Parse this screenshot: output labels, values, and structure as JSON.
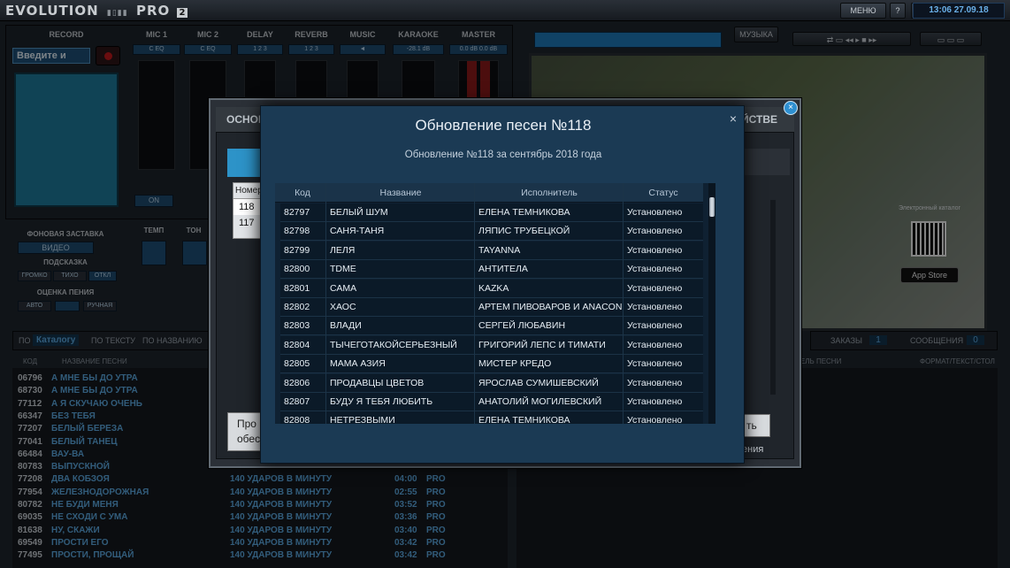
{
  "app": {
    "logo": "EVOLUTION",
    "logo_suffix": "PRO",
    "menu_label": "МЕНЮ",
    "help_label": "?",
    "clock": "13:06 27.09.18",
    "music_button": "МУЗЫКА"
  },
  "mixer": {
    "record_label": "RECORD",
    "record_input": "Введите и",
    "channels": [
      {
        "label": "MIC 1",
        "value": "C  EQ"
      },
      {
        "label": "MIC 2",
        "value": "C  EQ"
      },
      {
        "label": "DELAY",
        "value": "1  2  3"
      },
      {
        "label": "REVERB",
        "value": "1  2  3"
      },
      {
        "label": "MUSIC",
        "value": "◄"
      },
      {
        "label": "KARAOKE",
        "value": "-28.1 dB"
      },
      {
        "label": "MASTER",
        "value": "0.0 dB  0.0 dB"
      }
    ],
    "on_label": "ON",
    "background_label": "ФОНОВАЯ ЗАСТАВКА",
    "video_button": "ВИДЕО",
    "hint_label": "ПОДСКАЗКА",
    "hint_options": [
      "ГРОМКО",
      "ТИХО",
      "ОТКЛ"
    ],
    "rating_label": "ОЦЕНКА ПЕНИЯ",
    "rating_options": [
      "АВТО",
      "",
      "РУЧНАЯ"
    ],
    "tempo_label": "ТЕМП",
    "tone_label": "ТОН"
  },
  "video": {
    "catalog_text": "Электронный каталог",
    "appstore_text": "App Store"
  },
  "search": {
    "prefix": "ПО",
    "tabs": [
      "Каталогу",
      "ПО ТЕКСТУ",
      "ПО НАЗВАНИЮ"
    ],
    "col_code": "КОД",
    "col_title": "НАЗВАНИЕ ПЕСНИ",
    "col_artist_right": "ТЕЛЬ ПЕСНИ",
    "col_format": "ФОРМАТ/ТЕКСТ/СТОЛ"
  },
  "queue": {
    "orders_label": "ЗАКАЗЫ",
    "orders_count": "1",
    "messages_label": "СООБЩЕНИЯ",
    "messages_count": "0"
  },
  "bg_songs": [
    {
      "code": "06796",
      "title": "А МНЕ БЫ ДО УТРА",
      "artist": "",
      "time": "",
      "fmt": ""
    },
    {
      "code": "68730",
      "title": "А МНЕ БЫ ДО УТРА",
      "artist": "",
      "time": "",
      "fmt": ""
    },
    {
      "code": "77112",
      "title": "А Я СКУЧАЮ ОЧЕНЬ",
      "artist": "",
      "time": "",
      "fmt": ""
    },
    {
      "code": "66347",
      "title": "БЕЗ ТЕБЯ",
      "artist": "",
      "time": "",
      "fmt": ""
    },
    {
      "code": "77207",
      "title": "БЕЛЫЙ БЕРЕЗА",
      "artist": "",
      "time": "",
      "fmt": ""
    },
    {
      "code": "77041",
      "title": "БЕЛЫЙ ТАНЕЦ",
      "artist": "",
      "time": "",
      "fmt": ""
    },
    {
      "code": "66484",
      "title": "ВАУ-ВА",
      "artist": "",
      "time": "",
      "fmt": ""
    },
    {
      "code": "80783",
      "title": "ВЫПУСКНОЙ",
      "artist": "",
      "time": "",
      "fmt": ""
    },
    {
      "code": "77208",
      "title": "ДВА КОБЗОЯ",
      "artist": "140 УДАРОВ В МИНУТУ",
      "time": "04:00",
      "fmt": "PRO"
    },
    {
      "code": "77954",
      "title": "ЖЕЛЕЗНОДОРОЖНАЯ",
      "artist": "140 УДАРОВ В МИНУТУ",
      "time": "02:55",
      "fmt": "PRO"
    },
    {
      "code": "80782",
      "title": "НЕ БУДИ МЕНЯ",
      "artist": "140 УДАРОВ В МИНУТУ",
      "time": "03:52",
      "fmt": "PRO"
    },
    {
      "code": "69035",
      "title": "НЕ СХОДИ С УМА",
      "artist": "140 УДАРОВ В МИНУТУ",
      "time": "03:36",
      "fmt": "PRO"
    },
    {
      "code": "81638",
      "title": "НУ, СКАЖИ",
      "artist": "140 УДАРОВ В МИНУТУ",
      "time": "03:40",
      "fmt": "PRO"
    },
    {
      "code": "69549",
      "title": "ПРОСТИ ЕГО",
      "artist": "140 УДАРОВ В МИНУТУ",
      "time": "03:42",
      "fmt": "PRO"
    },
    {
      "code": "77495",
      "title": "ПРОСТИ, ПРОЩАЙ",
      "artist": "140 УДАРОВ В МИНУТУ",
      "time": "03:42",
      "fmt": "PRO"
    }
  ],
  "settings_dialog": {
    "tab_left": "ОСНОВЕ",
    "tab_right": "ЙСТВЕ",
    "col_number": "Номер",
    "numbers": [
      "118",
      "117"
    ],
    "bottom_left_1": "Про",
    "bottom_left_2": "обес",
    "bottom_right_1": "ть",
    "bottom_right_2": "ения"
  },
  "update_dialog": {
    "title": "Обновление песен №118",
    "subtitle": "Обновление №118 за сентябрь 2018 года",
    "close_icon": "×",
    "columns": {
      "code": "Код",
      "title": "Название",
      "artist": "Исполнитель",
      "status": "Статус"
    },
    "rows": [
      {
        "code": "82797",
        "title": "БЕЛЫЙ ШУМ",
        "artist": "ЕЛЕНА ТЕМНИКОВА",
        "status": "Установлено"
      },
      {
        "code": "82798",
        "title": "САНЯ-ТАНЯ",
        "artist": "ЛЯПИС ТРУБЕЦКОЙ",
        "status": "Установлено"
      },
      {
        "code": "82799",
        "title": "ЛЕЛЯ",
        "artist": "TAYANNA",
        "status": "Установлено"
      },
      {
        "code": "82800",
        "title": "TDME",
        "artist": "АНТИТЕЛА",
        "status": "Установлено"
      },
      {
        "code": "82801",
        "title": "САМА",
        "artist": "KAZKA",
        "status": "Установлено"
      },
      {
        "code": "82802",
        "title": "ХАОС",
        "artist": "АРТЕМ ПИВОВАРОВ И ANACONDAZ",
        "status": "Установлено"
      },
      {
        "code": "82803",
        "title": "ВЛАДИ",
        "artist": "СЕРГЕЙ ЛЮБАВИН",
        "status": "Установлено"
      },
      {
        "code": "82804",
        "title": "ТЫЧЕГОТАКОЙСЕРЬЕЗНЫЙ",
        "artist": "ГРИГОРИЙ ЛЕПС И ТИМАТИ",
        "status": "Установлено"
      },
      {
        "code": "82805",
        "title": "МАМА АЗИЯ",
        "artist": "МИСТЕР КРЕДО",
        "status": "Установлено"
      },
      {
        "code": "82806",
        "title": "ПРОДАВЦЫ ЦВЕТОВ",
        "artist": "ЯРОСЛАВ СУМИШЕВСКИЙ",
        "status": "Установлено"
      },
      {
        "code": "82807",
        "title": "БУДУ Я ТЕБЯ ЛЮБИТЬ",
        "artist": "АНАТОЛИЙ МОГИЛЕВСКИЙ",
        "status": "Установлено"
      },
      {
        "code": "82808",
        "title": "НЕТРЕЗВЫМИ",
        "artist": "ЕЛЕНА ТЕМНИКОВА",
        "status": "Установлено"
      }
    ]
  }
}
